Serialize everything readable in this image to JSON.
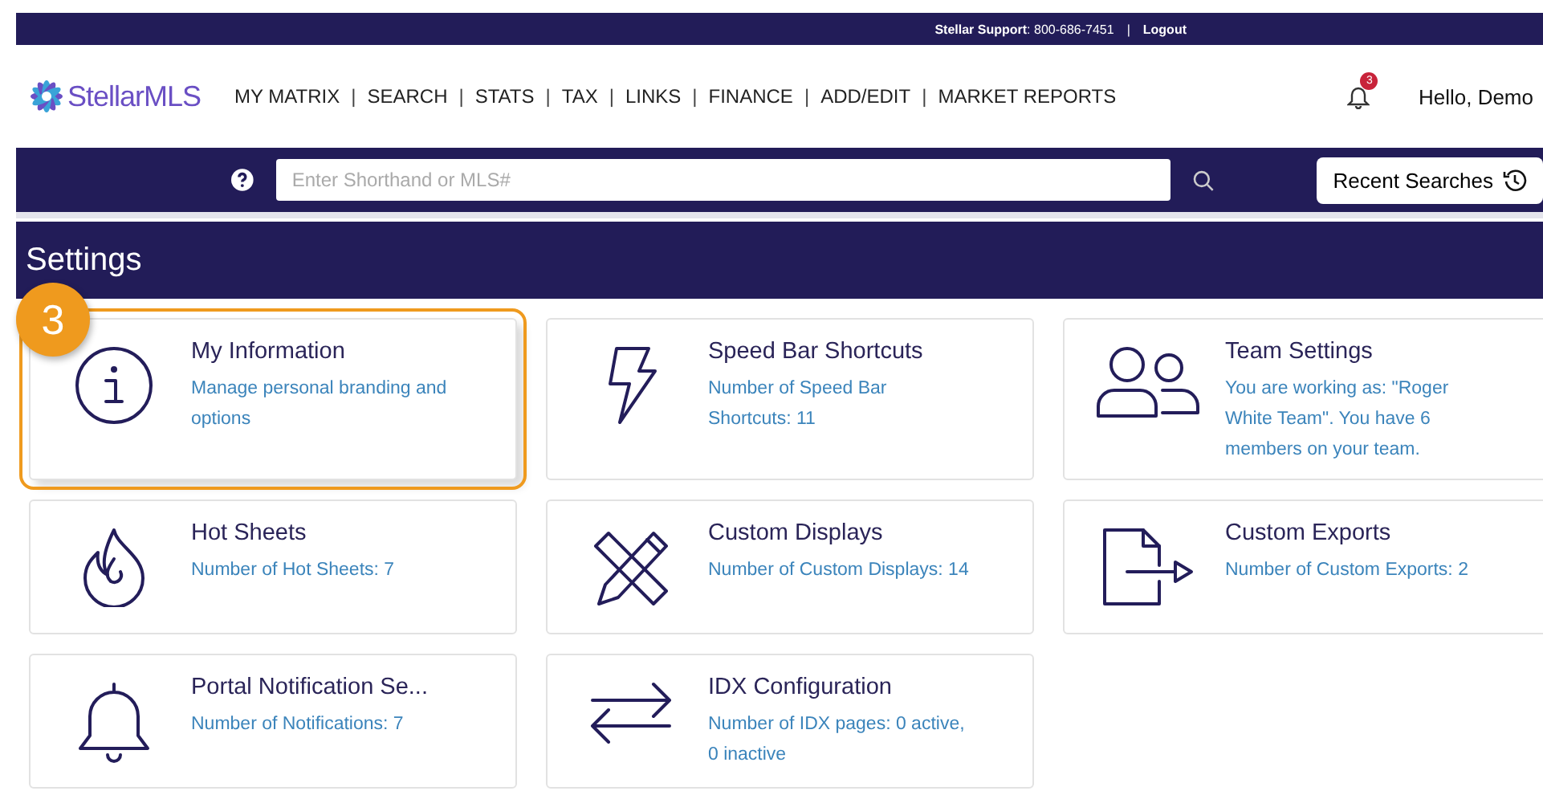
{
  "support_bar": {
    "support": "**Stellar Support**: 800-686-7451",
    "separator": "|",
    "logout": "Logout"
  },
  "header": {
    "logo": "StellarMLS",
    "nav": [
      "MY MATRIX",
      "SEARCH",
      "STATS",
      "TAX",
      "LINKS",
      "FINANCE",
      "ADD/EDIT",
      "MARKET REPORTS"
    ],
    "nav_separator": "|",
    "notification_count": "3",
    "greeting": "Hello, Demo"
  },
  "search": {
    "placeholder": "Enter Shorthand or MLS#",
    "recent_button": "Recent Searches"
  },
  "page_title": "Settings",
  "step_badge": "3",
  "cards": [
    {
      "kind": "info",
      "title": "My Information",
      "description": "Manage personal branding and options",
      "highlighted": true
    },
    {
      "kind": "bolt",
      "title": "Speed Bar Shortcuts",
      "description": "Number of Speed Bar Shortcuts: 11",
      "highlighted": false
    },
    {
      "kind": "team",
      "title": "Team Settings",
      "description": "You are working as: \"Roger White Team\". You have 6 members on your team.",
      "highlighted": false
    },
    {
      "kind": "flame",
      "title": "Hot Sheets",
      "description": "Number of Hot Sheets: 7",
      "highlighted": false
    },
    {
      "kind": "tools",
      "title": "Custom Displays",
      "description": "Number of Custom Displays: 14",
      "highlighted": false
    },
    {
      "kind": "export",
      "title": "Custom Exports",
      "description": "Number of Custom Exports: 2",
      "highlighted": false
    },
    {
      "kind": "bell",
      "title": "Portal Notification Se...",
      "description": "Number of Notifications: 7",
      "highlighted": false
    },
    {
      "kind": "swap",
      "title": "IDX Configuration",
      "description": "Number of IDX pages: 0 active, 0 inactive",
      "highlighted": false
    }
  ]
}
